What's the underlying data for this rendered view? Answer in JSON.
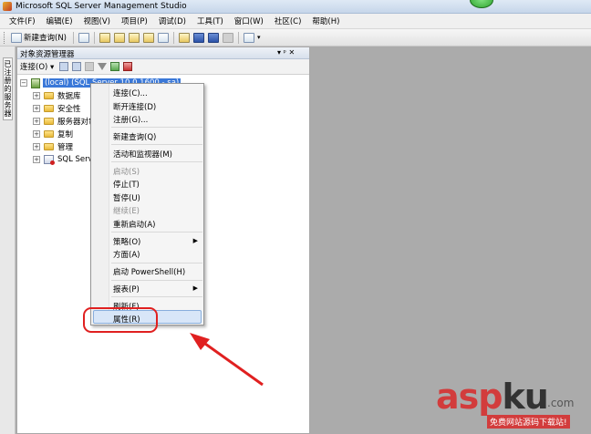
{
  "window": {
    "title": "Microsoft SQL Server Management Studio"
  },
  "menubar": [
    "文件(F)",
    "编辑(E)",
    "视图(V)",
    "项目(P)",
    "调试(D)",
    "工具(T)",
    "窗口(W)",
    "社区(C)",
    "帮助(H)"
  ],
  "toolbar": {
    "new_query_label": "新建查询(N)"
  },
  "side_tab": {
    "label": "已注册的服务器"
  },
  "object_explorer": {
    "title": "对象资源管理器",
    "pin": "▾ ᵖ ✕",
    "connect_label": "连接(O) ▾",
    "server_node": "(local) (SQL Server 10.0.1600 - sa)",
    "nodes": [
      "数据库",
      "安全性",
      "服务器对象",
      "复制",
      "管理",
      "SQL Server"
    ]
  },
  "context_menu": {
    "items": [
      {
        "label": "连接(C)...",
        "disabled": false
      },
      {
        "label": "断开连接(D)",
        "disabled": false
      },
      {
        "label": "注册(G)...",
        "disabled": false
      },
      {
        "label": "新建查询(Q)",
        "disabled": false
      },
      {
        "label": "活动和监视器(M)",
        "disabled": false
      },
      {
        "label": "启动(S)",
        "disabled": true
      },
      {
        "label": "停止(T)",
        "disabled": false
      },
      {
        "label": "暂停(U)",
        "disabled": false
      },
      {
        "label": "继续(E)",
        "disabled": true
      },
      {
        "label": "重新启动(A)",
        "disabled": false
      },
      {
        "label": "策略(O)",
        "disabled": false,
        "submenu": true
      },
      {
        "label": "方面(A)",
        "disabled": false
      },
      {
        "label": "启动 PowerShell(H)",
        "disabled": false
      },
      {
        "label": "报表(P)",
        "disabled": false,
        "submenu": true
      },
      {
        "label": "刷新(F)",
        "disabled": false
      },
      {
        "label": "属性(R)",
        "disabled": false,
        "highlighted": true
      }
    ]
  },
  "watermark": {
    "brand_a": "asp",
    "brand_b": "ku",
    "tld": ".com",
    "slogan": "免费网站源码下载站!"
  }
}
